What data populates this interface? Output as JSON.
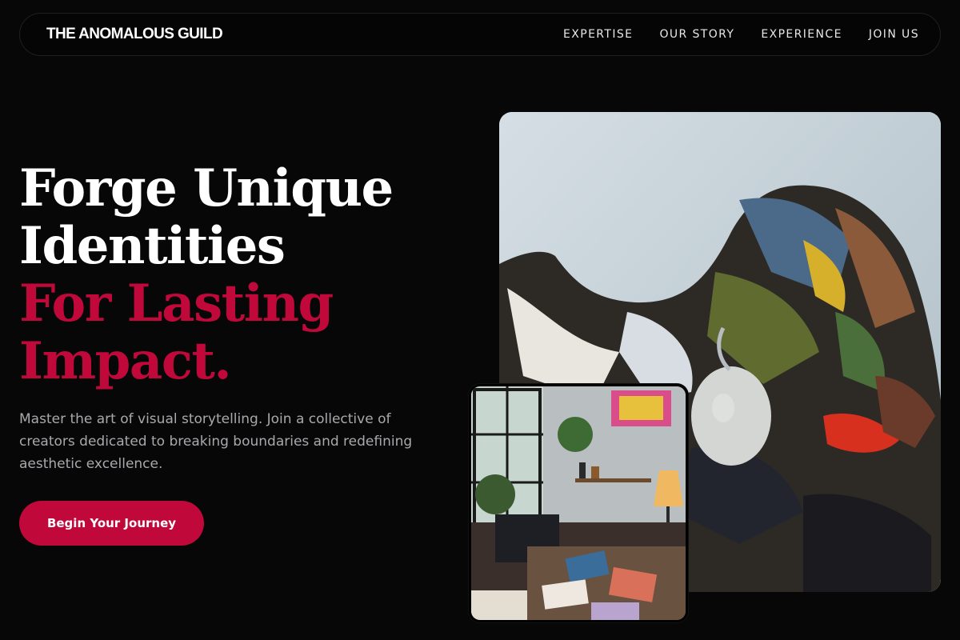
{
  "header": {
    "brand": "THE ANOMALOUS GUILD",
    "nav": [
      "EXPERTISE",
      "OUR STORY",
      "EXPERIENCE",
      "JOIN US"
    ]
  },
  "hero": {
    "title_line1": "Forge Unique",
    "title_line2": "Identities",
    "accent_line1": "For Lasting",
    "accent_line2": "Impact.",
    "description": "Master the art of visual storytelling. Join a collective of creators dedicated to breaking boundaries and redefining aesthetic excellence.",
    "cta_label": "Begin Your Journey"
  },
  "colors": {
    "background": "#070707",
    "accent": "#c0083a",
    "text": "#ffffff",
    "muted_text": "#a9a9ad"
  }
}
